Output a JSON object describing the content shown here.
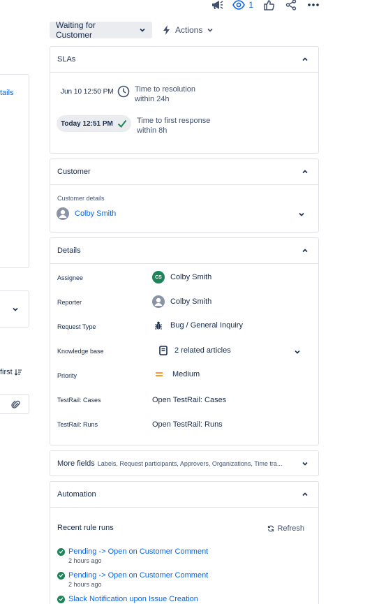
{
  "toolbar": {
    "watchers_count": "1",
    "icons": [
      "megaphone-icon",
      "eye-icon",
      "thumbs-up-icon",
      "share-icon",
      "more-icon"
    ]
  },
  "status": {
    "label": "Waiting for Customer"
  },
  "actions": {
    "label": "Actions"
  },
  "left_panel": {
    "link_fragment": "tails",
    "sort_label": "first"
  },
  "slas": {
    "title": "SLAs",
    "items": [
      {
        "date": "Jun 10 12:50 PM",
        "label": "Time to resolution",
        "sub": "within 24h"
      },
      {
        "date": "Today 12:51 PM",
        "label": "Time to first response",
        "sub": "within 8h"
      }
    ]
  },
  "customer": {
    "title": "Customer",
    "details_label": "Customer details",
    "name": "Colby Smith"
  },
  "details": {
    "title": "Details",
    "fields": [
      {
        "label": "Assignee",
        "value": "Colby Smith",
        "initials": "CS"
      },
      {
        "label": "Reporter",
        "value": "Colby Smith"
      },
      {
        "label": "Request Type",
        "value": "Bug / General Inquiry"
      },
      {
        "label": "Knowledge base",
        "value": "2 related articles"
      },
      {
        "label": "Priority",
        "value": "Medium"
      },
      {
        "label": "TestRail: Cases",
        "value": "Open TestRail: Cases"
      },
      {
        "label": "TestRail: Runs",
        "value": "Open TestRail: Runs"
      }
    ]
  },
  "more_fields": {
    "title": "More fields",
    "summary": "Labels, Request participants, Approvers, Organizations, Time tra..."
  },
  "automation": {
    "title": "Automation",
    "recent_label": "Recent rule runs",
    "refresh_label": "Refresh",
    "runs": [
      {
        "name": "Pending -> Open on Customer Comment",
        "time": "2 hours ago"
      },
      {
        "name": "Pending -> Open on Customer Comment",
        "time": "2 hours ago"
      },
      {
        "name": "Slack Notification upon Issue Creation",
        "time": ""
      }
    ]
  },
  "colors": {
    "accent": "#0c66e4",
    "success": "#1f845a",
    "priority_medium": "#ff991f",
    "border": "#dfe1e6"
  }
}
